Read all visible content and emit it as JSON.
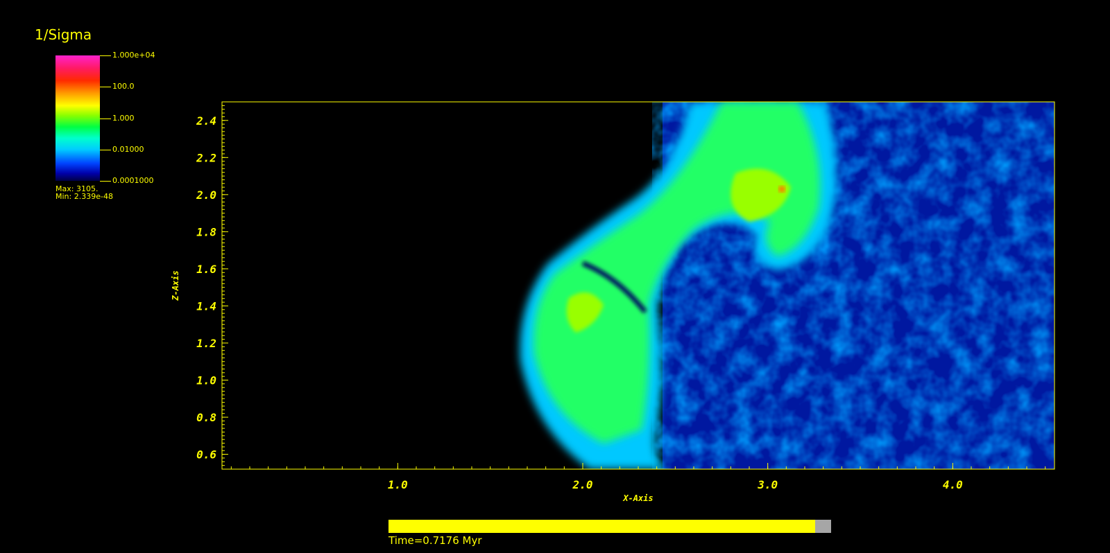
{
  "chart_data": {
    "type": "heatmap",
    "title": "1/Sigma",
    "xlabel": "X-Axis",
    "ylabel": "Z-Axis",
    "xlim": [
      0.05,
      4.55
    ],
    "ylim": [
      0.52,
      2.5
    ],
    "x_ticks": [
      "1.0",
      "2.0",
      "3.0",
      "4.0"
    ],
    "x_tick_values": [
      1.0,
      2.0,
      3.0,
      4.0
    ],
    "y_ticks": [
      "2.4",
      "2.2",
      "2.0",
      "1.8",
      "1.6",
      "1.4",
      "1.2",
      "1.0",
      "0.8",
      "0.6"
    ],
    "y_tick_values": [
      2.4,
      2.2,
      2.0,
      1.8,
      1.6,
      1.4,
      1.2,
      1.0,
      0.8,
      0.6
    ],
    "colorbar": {
      "scale": "log",
      "labels": [
        "1.000e+04",
        "100.0",
        "1.000",
        "0.01000",
        "0.0001000"
      ],
      "values": [
        10000,
        100,
        1,
        0.01,
        0.0001
      ]
    },
    "max_label": "Max:  3105.",
    "min_label": "Min:  2.339e-48",
    "time_label": "Time=0.7176 Myr",
    "time_progress": 0.964
  }
}
